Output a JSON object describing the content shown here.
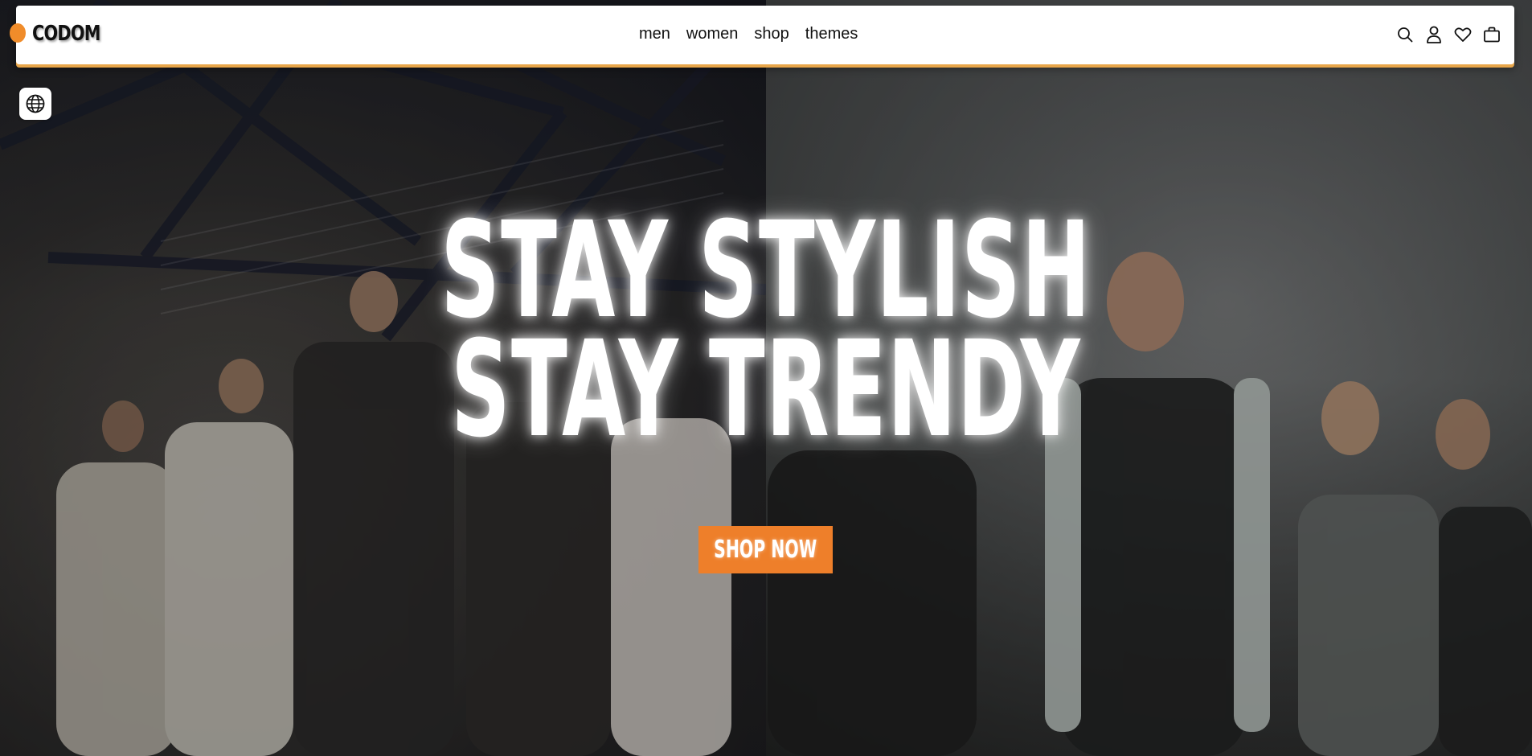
{
  "brand": {
    "logo_text": "CODOM"
  },
  "nav": {
    "items": [
      {
        "label": "men"
      },
      {
        "label": "women"
      },
      {
        "label": "shop"
      },
      {
        "label": "themes"
      }
    ]
  },
  "header_icons": [
    "search-icon",
    "user-icon",
    "heart-icon",
    "bag-icon"
  ],
  "language_button": {
    "icon": "globe-icon"
  },
  "hero": {
    "headline_line_1": "STAY STYLISH",
    "headline_line_2": "STAY TRENDY",
    "cta_label": "SHOP NOW"
  },
  "colors": {
    "accent": "#ee7f2a",
    "header_bg": "#ffffff",
    "text": "#111111",
    "headline": "#ffffff"
  }
}
